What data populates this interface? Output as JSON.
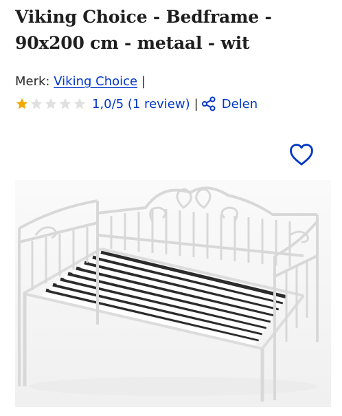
{
  "product": {
    "title": "Viking Choice - Bedframe - 90x200 cm - metaal - wit"
  },
  "brand": {
    "label": "Merk:",
    "name": "Viking Choice",
    "separator": "|"
  },
  "rating": {
    "score": 1,
    "max": 5,
    "text": "1,0/5 (1 review)",
    "separator": "|",
    "filled_color": "#f2a800",
    "empty_color": "#e0e0e0"
  },
  "share": {
    "label": "Delen",
    "icon": "share-icon"
  },
  "wishlist": {
    "icon": "heart-icon"
  },
  "colors": {
    "accent": "#0036c8"
  }
}
